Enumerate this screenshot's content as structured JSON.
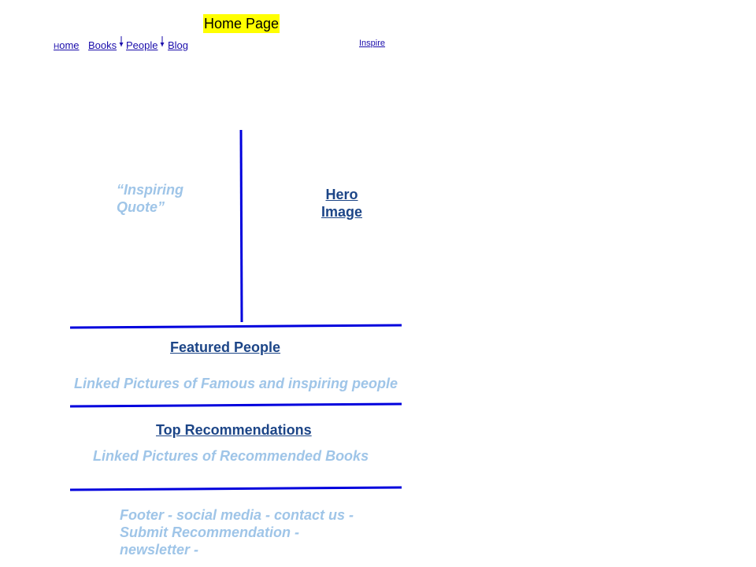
{
  "page_title": "Home Page",
  "nav": {
    "home_first": "H",
    "home_rest": "ome",
    "books": "Books",
    "people": "People",
    "blog": "Blog",
    "inspire": "Inspire"
  },
  "hero": {
    "quote": "“Inspiring Quote”",
    "image_label": "Hero Image"
  },
  "featured": {
    "heading": "Featured People",
    "description": "Linked Pictures of Famous and inspiring people"
  },
  "recommendations": {
    "heading": "Top Recommendations",
    "description": "Linked Pictures of Recommended Books"
  },
  "footer": {
    "text": "Footer - social media - contact us - Submit Recommendation - newsletter -"
  },
  "colors": {
    "title_highlight": "#ffff00",
    "wire_lines": "#0000dd",
    "heading": "#1c4587",
    "placeholder": "#9fc5e8",
    "link": "#1a0dab"
  }
}
